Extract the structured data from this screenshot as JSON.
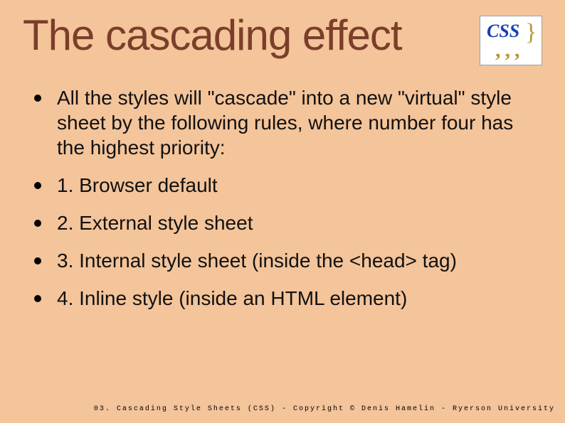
{
  "title": "The cascading effect",
  "logo": {
    "text": "CSS",
    "brace": "}",
    "commas": ",,,"
  },
  "bullets": [
    "All the styles will \"cascade\" into a new \"virtual\" style sheet by the following rules, where number four has the highest priority:",
    "1. Browser default",
    "2. External style sheet",
    "3. Internal style sheet (inside the <head> tag)",
    "4. Inline style (inside an HTML element)"
  ],
  "footer": "03. Cascading Style Sheets (CSS) - Copyright © Denis Hamelin - Ryerson University"
}
